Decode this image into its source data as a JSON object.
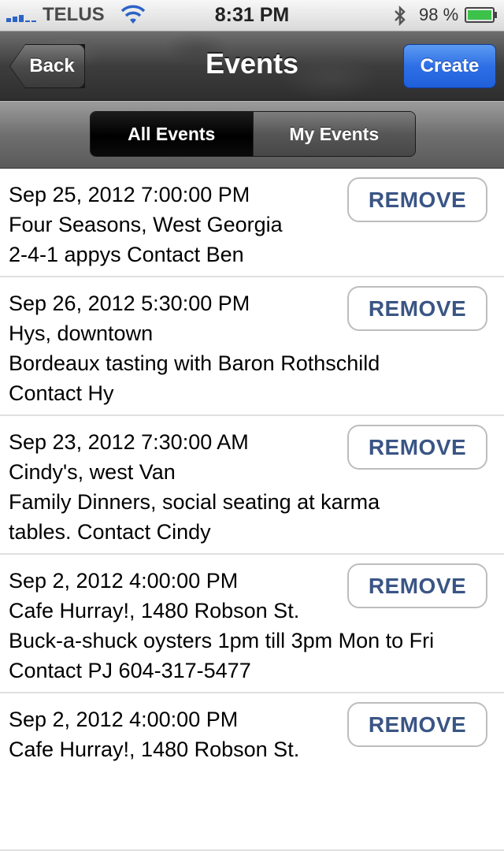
{
  "status_bar": {
    "carrier": "TELUS",
    "time": "8:31 PM",
    "battery_percent": "98 %",
    "icons": [
      "signal-icon",
      "wifi-icon",
      "bluetooth-icon",
      "battery-icon"
    ]
  },
  "nav": {
    "back_label": "Back",
    "title": "Events",
    "create_label": "Create"
  },
  "segments": {
    "all_events": "All Events",
    "my_events": "My Events",
    "selected": "All Events"
  },
  "colors": {
    "create_button": "#2f6fe6",
    "remove_text": "#3a5585"
  },
  "events": [
    {
      "datetime": "Sep 25, 2012 7:00:00 PM",
      "location": "Four Seasons, West Georgia",
      "details": [
        "2-4-1 appys Contact Ben"
      ],
      "remove_label": "REMOVE"
    },
    {
      "datetime": "Sep 26, 2012 5:30:00 PM",
      "location": "Hys, downtown",
      "details": [
        "Bordeaux tasting with Baron Rothschild",
        "Contact Hy"
      ],
      "remove_label": "REMOVE"
    },
    {
      "datetime": "Sep 23, 2012 7:30:00 AM",
      "location": "Cindy's, west Van",
      "details": [
        "Family Dinners, social seating at karma",
        "tables. Contact Cindy"
      ],
      "remove_label": "REMOVE"
    },
    {
      "datetime": "Sep 2, 2012 4:00:00 PM",
      "location": "Cafe Hurray!, 1480 Robson St.",
      "details": [
        "Buck-a-shuck oysters 1pm till 3pm Mon to Fri",
        "Contact PJ 604-317-5477"
      ],
      "remove_label": "REMOVE"
    },
    {
      "datetime": "Sep 2, 2012 4:00:00 PM",
      "location": "Cafe Hurray!, 1480 Robson St.",
      "details": [],
      "remove_label": "REMOVE"
    }
  ]
}
